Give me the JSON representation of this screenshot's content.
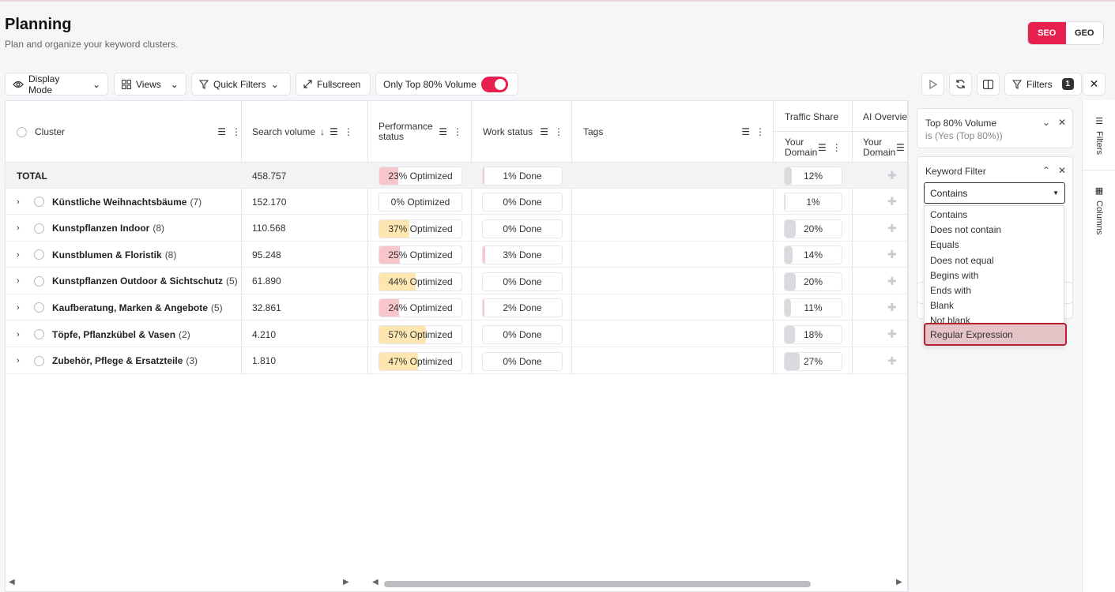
{
  "header": {
    "title": "Planning",
    "subtitle": "Plan and organize your keyword clusters.",
    "mode_options": [
      "SEO",
      "GEO"
    ],
    "active_mode": "SEO"
  },
  "toolbar": {
    "display_mode": "Display Mode",
    "views": "Views",
    "quick_filters": "Quick Filters",
    "fullscreen": "Fullscreen",
    "top80_label": "Only Top 80% Volume",
    "top80_on": true,
    "filters_label": "Filters",
    "filters_count": "1"
  },
  "grid": {
    "columns": {
      "cluster": "Cluster",
      "search_volume": "Search volume",
      "performance": "Performance status",
      "work": "Work status",
      "tags": "Tags",
      "traffic_share": "Traffic Share",
      "traffic_sub": "Your Domain",
      "ai_overview": "AI Overview",
      "ai_sub": "Your Domain"
    },
    "total": {
      "label": "TOTAL",
      "volume": "458.757",
      "performance": "23% Optimized",
      "performance_pct": 23,
      "work": "1% Done",
      "work_pct": 1,
      "traffic": "12%",
      "traffic_pct": 12
    },
    "rows": [
      {
        "name": "Künstliche Weihnachtsbäume",
        "count": "(7)",
        "volume": "152.170",
        "performance": "0% Optimized",
        "performance_pct": 0,
        "work": "0% Done",
        "work_pct": 0,
        "traffic": "1%",
        "traffic_pct": 1
      },
      {
        "name": "Kunstpflanzen Indoor",
        "count": "(8)",
        "volume": "110.568",
        "performance": "37% Optimized",
        "performance_pct": 37,
        "work": "0% Done",
        "work_pct": 0,
        "traffic": "20%",
        "traffic_pct": 20
      },
      {
        "name": "Kunstblumen & Floristik",
        "count": "(8)",
        "volume": "95.248",
        "performance": "25% Optimized",
        "performance_pct": 25,
        "work": "3% Done",
        "work_pct": 3,
        "traffic": "14%",
        "traffic_pct": 14
      },
      {
        "name": "Kunstpflanzen Outdoor & Sichtschutz",
        "count": "(5)",
        "volume": "61.890",
        "performance": "44% Optimized",
        "performance_pct": 44,
        "work": "0% Done",
        "work_pct": 0,
        "traffic": "20%",
        "traffic_pct": 20
      },
      {
        "name": "Kaufberatung, Marken & Angebote",
        "count": "(5)",
        "volume": "32.861",
        "performance": "24% Optimized",
        "performance_pct": 24,
        "work": "2% Done",
        "work_pct": 2,
        "traffic": "11%",
        "traffic_pct": 11
      },
      {
        "name": "Töpfe, Pflanzkübel & Vasen",
        "count": "(2)",
        "volume": "4.210",
        "performance": "57% Optimized",
        "performance_pct": 57,
        "work": "0% Done",
        "work_pct": 0,
        "traffic": "18%",
        "traffic_pct": 18
      },
      {
        "name": "Zubehör, Pflege & Ersatzteile",
        "count": "(3)",
        "volume": "1.810",
        "performance": "47% Optimized",
        "performance_pct": 47,
        "work": "0% Done",
        "work_pct": 0,
        "traffic": "27%",
        "traffic_pct": 27
      }
    ]
  },
  "filters_panel": {
    "top80_title": "Top 80% Volume",
    "top80_value": "is (Yes (Top 80%))",
    "keyword_title": "Keyword Filter",
    "selected": "Contains",
    "options": [
      "Contains",
      "Does not contain",
      "Equals",
      "Does not equal",
      "Begins with",
      "Ends with",
      "Blank",
      "Not blank",
      "Regular Expression"
    ],
    "highlighted": "Regular Expression"
  },
  "side_tabs": {
    "filters": "Filters",
    "columns": "Columns"
  },
  "colors": {
    "accent": "#e8204f",
    "perf_low": "#f7c6ca",
    "perf_mid": "#fde6b0",
    "traffic_fill": "#d9d9de"
  }
}
